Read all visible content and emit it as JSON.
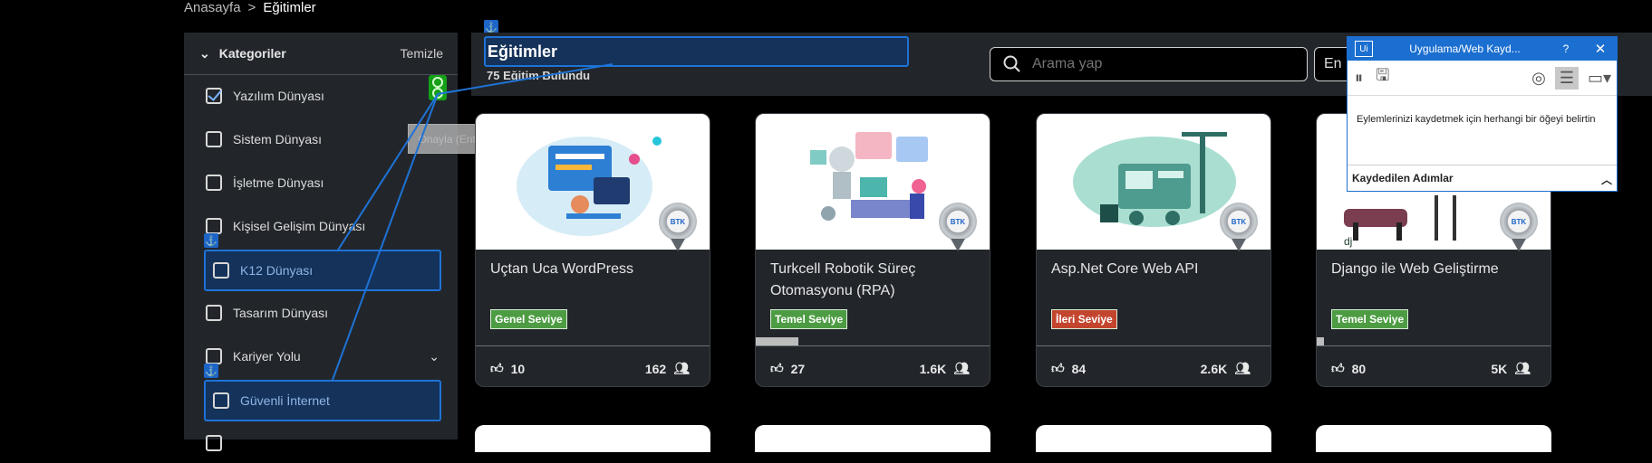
{
  "breadcrumb": {
    "home": "Anasayfa",
    "separator": ">",
    "current": "Eğitimler"
  },
  "sidebar": {
    "title": "Kategoriler",
    "clear_label": "Temizle",
    "items": [
      {
        "label": "Yazılım Dünyası",
        "checked": true
      },
      {
        "label": "Sistem Dünyası",
        "checked": false
      },
      {
        "label": "İşletme Dünyası",
        "checked": false
      },
      {
        "label": "Kişisel Gelişim Dünyası",
        "checked": false
      },
      {
        "label": "K12 Dünyası",
        "checked": false
      },
      {
        "label": "Tasarım Dünyası",
        "checked": false
      },
      {
        "label": "Kariyer Yolu",
        "checked": false
      },
      {
        "label": "Güvenli İnternet",
        "checked": false
      }
    ]
  },
  "tooltip": "Onayla (Enter)",
  "header": {
    "title": "Eğitimler",
    "count": "75 Eğitim Bulundu",
    "search_placeholder": "Arama yap",
    "sort_label": "En"
  },
  "courses": [
    {
      "name": "Uçtan Uca WordPress",
      "level": "Genel Seviye",
      "level_color": "#4d9c43",
      "likes": "10",
      "students": "162",
      "progress": 0,
      "badge": "BTK"
    },
    {
      "name": "Turkcell Robotik Süreç Otomasyonu (RPA)",
      "level": "Temel Seviye",
      "level_color": "#4d9c43",
      "likes": "27",
      "students": "1.6K",
      "progress": 0.18,
      "badge": "BTK"
    },
    {
      "name": "Asp.Net Core Web API",
      "level": "İleri Seviye",
      "level_color": "#c4452e",
      "likes": "84",
      "students": "2.6K",
      "progress": 0,
      "badge": "BTK"
    },
    {
      "name": "Django ile Web Geliştirme",
      "level": "Temel Seviye",
      "level_color": "#4d9c43",
      "likes": "80",
      "students": "5K",
      "progress": 0.03,
      "badge": "BTK"
    }
  ],
  "recorder": {
    "title": "Uygulama/Web Kayd...",
    "help": "?",
    "close": "✕",
    "logo": "Ui",
    "message": "Eylemlerinizi kaydetmek için herhangi bir öğeyi belirtin",
    "steps_label": "Kaydedilen Adımlar"
  },
  "colors": {
    "accent": "#1e73d6",
    "recorder_bar": "#1b6fd0",
    "green_level": "#4d9c43",
    "red_level": "#c4452e"
  }
}
